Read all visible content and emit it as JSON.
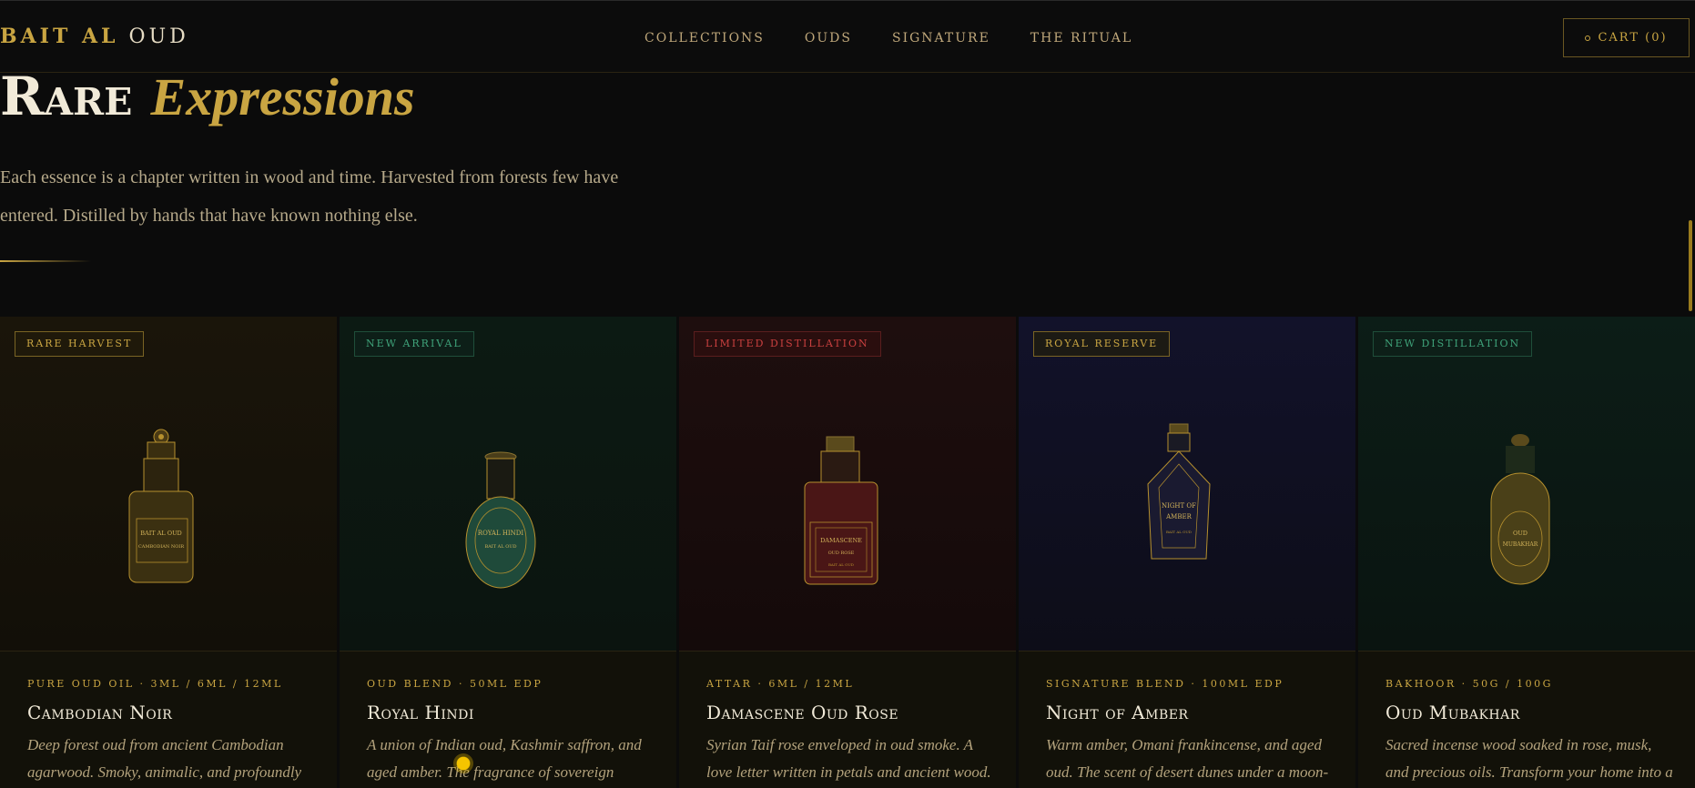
{
  "nav": {
    "logo_bold": "BAIT AL",
    "logo_light": "OUD",
    "links": [
      "COLLECTIONS",
      "OUDS",
      "SIGNATURE",
      "THE RITUAL"
    ],
    "cart_label": "CART (0)"
  },
  "hero": {
    "title_main": "Rare",
    "title_italic": "Expressions",
    "description": "Each essence is a chapter written in wood and time. Harvested from forests few have entered. Distilled by hands that have known nothing else."
  },
  "products": [
    {
      "badge": "RARE HARVEST",
      "badge_color": "#c9a542",
      "meta": "PURE OUD OIL · 3ML / 6ML / 12ML",
      "name": "Cambodian Noir",
      "description": "Deep forest oud from ancient Cambodian agarwood. Smoky, animalic, and profoundly",
      "label_lines": [
        "BAIT AL OUD",
        "CAMBODIAN NOIR"
      ]
    },
    {
      "badge": "NEW ARRIVAL",
      "badge_color": "#3fa37a",
      "meta": "OUD BLEND · 50ML EDP",
      "name": "Royal Hindi",
      "description": "A union of Indian oud, Kashmir saffron, and aged amber. The fragrance of sovereign courts.",
      "label_lines": [
        "ROYAL HINDI",
        "BAIT AL OUD"
      ]
    },
    {
      "badge": "LIMITED DISTILLATION",
      "badge_color": "#c9403f",
      "meta": "ATTAR · 6ML / 12ML",
      "name": "Damascene Oud Rose",
      "description": "Syrian Taif rose enveloped in oud smoke. A love letter written in petals and ancient wood.",
      "label_lines": [
        "DAMASCENE",
        "OUD ROSE",
        "BAIT AL OUD"
      ]
    },
    {
      "badge": "ROYAL RESERVE",
      "badge_color": "#c9a542",
      "meta": "SIGNATURE BLEND · 100ML EDP",
      "name": "Night of Amber",
      "description": "Warm amber, Omani frankincense, and aged oud. The scent of desert dunes under a moon-",
      "label_lines": [
        "NIGHT OF",
        "AMBER",
        "BAIT AL OUD"
      ]
    },
    {
      "badge": "NEW DISTILLATION",
      "badge_color": "#3fa37a",
      "meta": "BAKHOOR · 50G / 100G",
      "name": "Oud Mubakhar",
      "description": "Sacred incense wood soaked in rose, musk, and precious oils. Transform your home into a",
      "label_lines": [
        "OUD",
        "MUBAKHAR"
      ]
    }
  ],
  "colors": {
    "gold": "#c9a542",
    "background": "#0b0b0b"
  }
}
